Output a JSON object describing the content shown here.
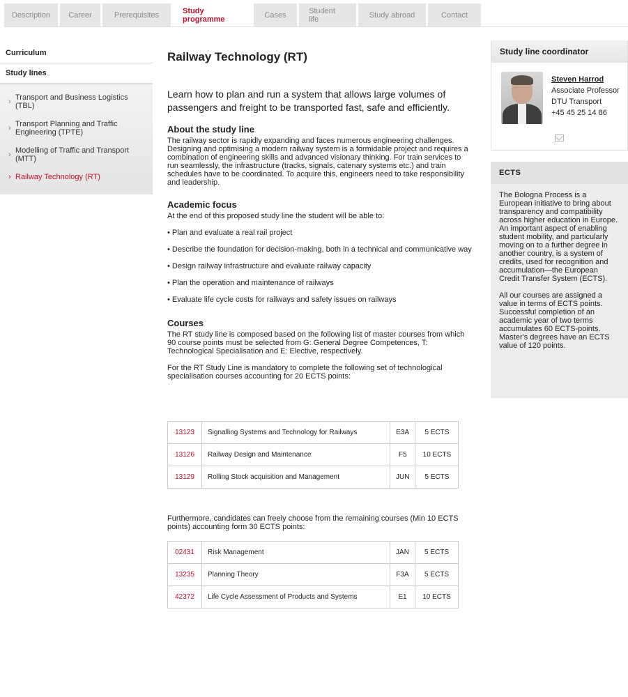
{
  "tabs": [
    "Description",
    "Career",
    "Prerequisites",
    "Study programme",
    "Cases",
    "Student life",
    "Study abroad",
    "Contact"
  ],
  "sidebar": {
    "curriculum": "Curriculum",
    "study_lines": "Study lines",
    "items": [
      "Transport and Business Logistics (TBL)",
      "Transport Planning and Traffic Engineering (TPTE)",
      "Modelling of Traffic and Transport (MTT)",
      "Railway Technology (RT)"
    ]
  },
  "main": {
    "title": "Railway Technology (RT)",
    "intro": "Learn how to plan and run a system that allows large volumes of passengers and freight to be transported fast, safe and efficiently.",
    "about_heading": "About the study line",
    "about_text": "The railway sector is rapidly expanding and faces numerous engineering challenges.  Designing and optimising a modern railway system is a formidable project and requires a combination of engineering skills and advanced visionary thinking. For train services to run seamlessly, the infrastructure (tracks, signals, catenary systems etc.) and train schedules have to be coordinated. To acquire this, engineers need to take responsibility and leadership.",
    "focus_heading": "Academic focus",
    "focus_intro": "At the end of this proposed study line the student will be able to:",
    "focus_bullets": [
      "• Plan and evaluate a real rail project",
      "• Describe the foundation for decision-making, both in a technical and communicative way",
      "• Design railway infrastructure and evaluate railway capacity",
      "• Plan the operation and maintenance of railways",
      "• Evaluate life cycle costs for railways and safety issues on railways"
    ],
    "courses_heading": "Courses",
    "courses_text1": "The RT study line is composed based on the following list of master courses from which 90 course points must be selected from G: General Degree Competences, T: Technological Specialisation and E: Elective, respectively.",
    "courses_text2": "For the RT Study Line is mandatory to complete the following set of technological specialisation courses accounting for 20 ECTS points:",
    "mandatory_courses": [
      {
        "code": "13123",
        "name": "Signalling Systems and Technology for Railways",
        "semester": "E3A",
        "ects": "5 ECTS"
      },
      {
        "code": "13126",
        "name": "Railway Design and Maintenance",
        "semester": "F5",
        "ects": "10 ECTS"
      },
      {
        "code": "13129",
        "name": "Rolling Stock acquisition and Management",
        "semester": "JUN",
        "ects": "5 ECTS"
      }
    ],
    "courses_text3": "Furthermore, candidates can freely choose from the remaining courses (Min 10 ECTS points) accounting form 30 ECTS points:",
    "elective_courses": [
      {
        "code": "02431",
        "name": "Risk Management",
        "semester": "JAN",
        "ects": "5 ECTS"
      },
      {
        "code": "13235",
        "name": "Planning Theory",
        "semester": "F3A",
        "ects": "5 ECTS"
      },
      {
        "code": "42372",
        "name": "Life Cycle Assessment of Products and Systems",
        "semester": "E1",
        "ects": "10 ECTS"
      }
    ]
  },
  "coordinator": {
    "heading": "Study line coordinator",
    "name": "Steven Harrod",
    "role": "Associate Professor",
    "dept": "DTU Transport",
    "phone": "+45 45 25 14 86"
  },
  "ects": {
    "heading": "ECTS",
    "p1": "The Bologna Process is a European initiative to bring about transparency and compatibility across higher education in Europe. An important aspect of enabling student mobility, and particularly moving on to a further degree in another country, is a system of credits, used for recognition and accumulation—the European Credit Transfer System (ECTS).",
    "p2": "All our courses are assigned a value in terms of ECTS points. Successful completion of an academic year of two terms accumulates 60 ECTS-points. Master's degrees have an ECTS value of 120 points."
  },
  "colors": {
    "accent": "#c0122a"
  }
}
